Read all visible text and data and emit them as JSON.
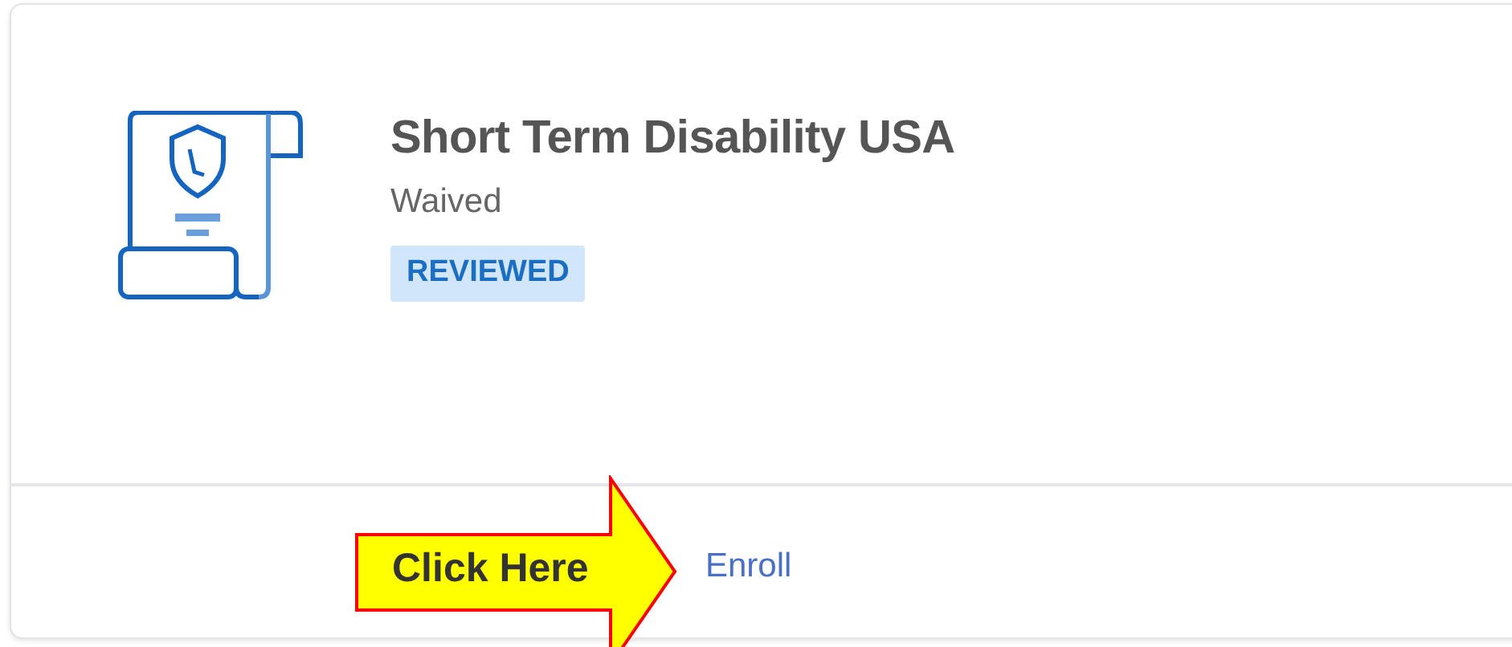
{
  "plan": {
    "title": "Short Term Disability USA",
    "status": "Waived",
    "badge": "REVIEWED"
  },
  "footer": {
    "link": "Enroll"
  },
  "callout": {
    "label": "Click Here"
  }
}
